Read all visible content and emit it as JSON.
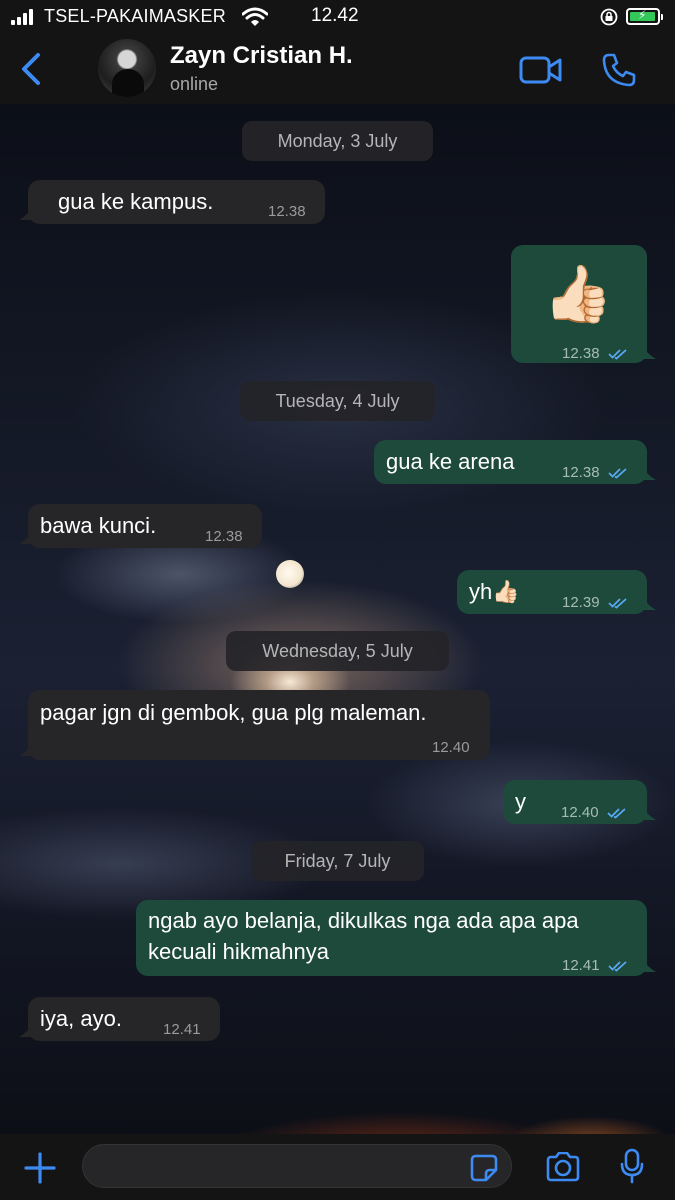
{
  "status_bar": {
    "carrier": "TSEL-PAKAIMASKER",
    "time": "12.42"
  },
  "header": {
    "back_icon": "chevron-left-icon",
    "contact_name": "Zayn Cristian H.",
    "contact_status": "online",
    "video_icon": "video-camera-icon",
    "phone_icon": "phone-icon"
  },
  "chat": {
    "messages": [
      {
        "type": "date",
        "text": "Monday, 3 July"
      },
      {
        "type": "incoming",
        "text": "gua ke kampus.",
        "time": "12.38"
      },
      {
        "type": "outgoing",
        "text": "👍🏻",
        "time": "12.38",
        "read": true
      },
      {
        "type": "date",
        "text": "Tuesday, 4 July"
      },
      {
        "type": "outgoing",
        "text": "gua ke arena",
        "time": "12.38",
        "read": true
      },
      {
        "type": "incoming",
        "text": "bawa kunci.",
        "time": "12.38"
      },
      {
        "type": "outgoing",
        "text": "yh👍🏻",
        "time": "12.39",
        "read": true
      },
      {
        "type": "date",
        "text": "Wednesday, 5 July"
      },
      {
        "type": "incoming",
        "text": "pagar jgn di gembok, gua plg maleman.",
        "time": "12.40"
      },
      {
        "type": "outgoing",
        "text": "y",
        "time": "12.40",
        "read": true
      },
      {
        "type": "date",
        "text": "Friday, 7 July"
      },
      {
        "type": "outgoing",
        "text_line1": "ngab ayo belanja, dikulkas nga ada apa apa",
        "text_line2": "kecuali hikmahnya",
        "time": "12.41",
        "read": true
      },
      {
        "type": "incoming",
        "text": "iya, ayo.",
        "time": "12.41"
      }
    ]
  },
  "input_bar": {
    "plus_icon": "plus-icon",
    "sticker_icon": "sticker-icon",
    "camera_icon": "camera-icon",
    "mic_icon": "microphone-icon",
    "placeholder": ""
  },
  "colors": {
    "accent": "#3d8bf2",
    "outgoing_bubble": "#1e4a3c",
    "incoming_bubble": "#262628",
    "read_ticks": "#58a9f5"
  }
}
